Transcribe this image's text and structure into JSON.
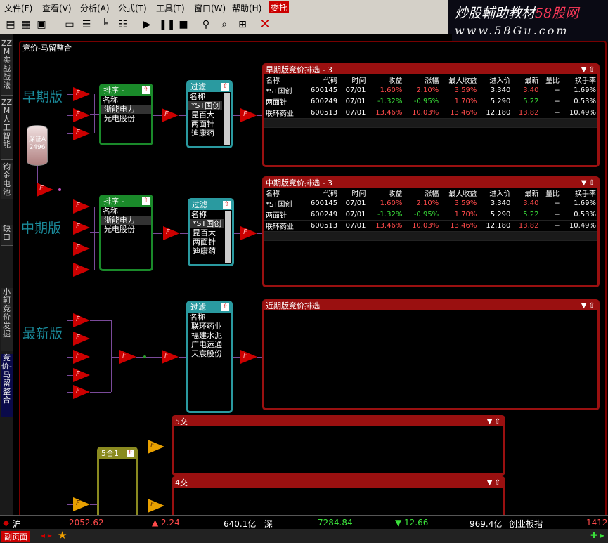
{
  "menu": [
    "文件(F)",
    "查看(V)",
    "分析(A)",
    "公式(T)",
    "工具(T)",
    "窗口(W)",
    "帮助(H)",
    "委托"
  ],
  "brand": {
    "line1a": "炒股輔助教材",
    "line1b": "58股网",
    "line2": "www.58Gu.com"
  },
  "toolbar_icons": [
    "open-icon",
    "save-icon",
    "print-icon",
    "layout1-icon",
    "layout2-icon",
    "layout3-icon",
    "layout4-icon",
    "play-icon",
    "pause-icon",
    "stop-icon",
    "zoom-icon",
    "find-icon",
    "chart-icon",
    "close-icon"
  ],
  "window_title": "竞价-马留整合",
  "left_tabs": [
    "ZZM实战战法",
    "ZZM人工智能",
    "钧金电池",
    "缺口",
    "小轲竞价发掘",
    "竞价-马留整合"
  ],
  "sections": {
    "early": "早期版",
    "mid": "中期版",
    "latest": "最新版"
  },
  "db_node": {
    "label": "深证A",
    "value": "2496"
  },
  "sort_box": {
    "title": "排序 -",
    "col": "名称",
    "items": [
      "浙能电力",
      "光电股份"
    ]
  },
  "sort_box2": {
    "title": "排序 -",
    "col": "名称",
    "items": [
      "浙能电力",
      "光电股份"
    ]
  },
  "filter_box1": {
    "title": "过滤",
    "col": "名称",
    "items": [
      "*ST国创",
      "昆百大",
      "两面针",
      "迪康药"
    ]
  },
  "filter_box2": {
    "title": "过滤",
    "col": "名称",
    "items": [
      "*ST国创",
      "昆百大",
      "两面针",
      "迪康药"
    ]
  },
  "filter_box3": {
    "title": "过滤",
    "col": "名称",
    "items": [
      "联环药业",
      "福建水泥",
      "广电运通",
      "天宸股份"
    ]
  },
  "merge_box": {
    "title": "5合1"
  },
  "table_headers": [
    "名称",
    "代码",
    "时间",
    "收益",
    "涨幅",
    "最大收益",
    "进入价",
    "最新",
    "量比",
    "换手率"
  ],
  "panel1": {
    "title": "早期版竞价排选 - 3",
    "rows": [
      [
        "*ST国创",
        "600145",
        "07/01",
        "1.60%",
        "2.10%",
        "3.59%",
        "3.340",
        "3.40",
        "--",
        "1.69%"
      ],
      [
        "两面针",
        "600249",
        "07/01",
        "-1.32%",
        "-0.95%",
        "1.70%",
        "5.290",
        "5.22",
        "--",
        "0.53%"
      ],
      [
        "联环药业",
        "600513",
        "07/01",
        "13.46%",
        "10.03%",
        "13.46%",
        "12.180",
        "13.82",
        "--",
        "10.49%"
      ]
    ]
  },
  "panel2": {
    "title": "中期版竞价排选 - 3",
    "rows": [
      [
        "*ST国创",
        "600145",
        "07/01",
        "1.60%",
        "2.10%",
        "3.59%",
        "3.340",
        "3.40",
        "--",
        "1.69%"
      ],
      [
        "两面针",
        "600249",
        "07/01",
        "-1.32%",
        "-0.95%",
        "1.70%",
        "5.290",
        "5.22",
        "--",
        "0.53%"
      ],
      [
        "联环药业",
        "600513",
        "07/01",
        "13.46%",
        "10.03%",
        "13.46%",
        "12.180",
        "13.82",
        "--",
        "10.49%"
      ]
    ]
  },
  "panel3": {
    "title": "近期版竞价排选"
  },
  "panel4": {
    "title": "5交"
  },
  "panel5": {
    "title": "4交"
  },
  "status": {
    "sh_label": "沪",
    "sh_index": "2052.62",
    "sh_change": "▲ 2.24",
    "sh_amount": "640.1亿",
    "sz_label": "深",
    "sz_index": "7284.84",
    "sz_change": "▼ 12.66",
    "sz_amount": "969.4亿",
    "cy_label": "创业板指",
    "cy_index": "1412"
  },
  "bottom": {
    "label": "副页面"
  },
  "colors": {
    "accent": "#9a1010",
    "up": "#ff4a4a",
    "down": "#3ae03a",
    "teal": "#2a9aa0",
    "green": "#1a8a2a"
  }
}
